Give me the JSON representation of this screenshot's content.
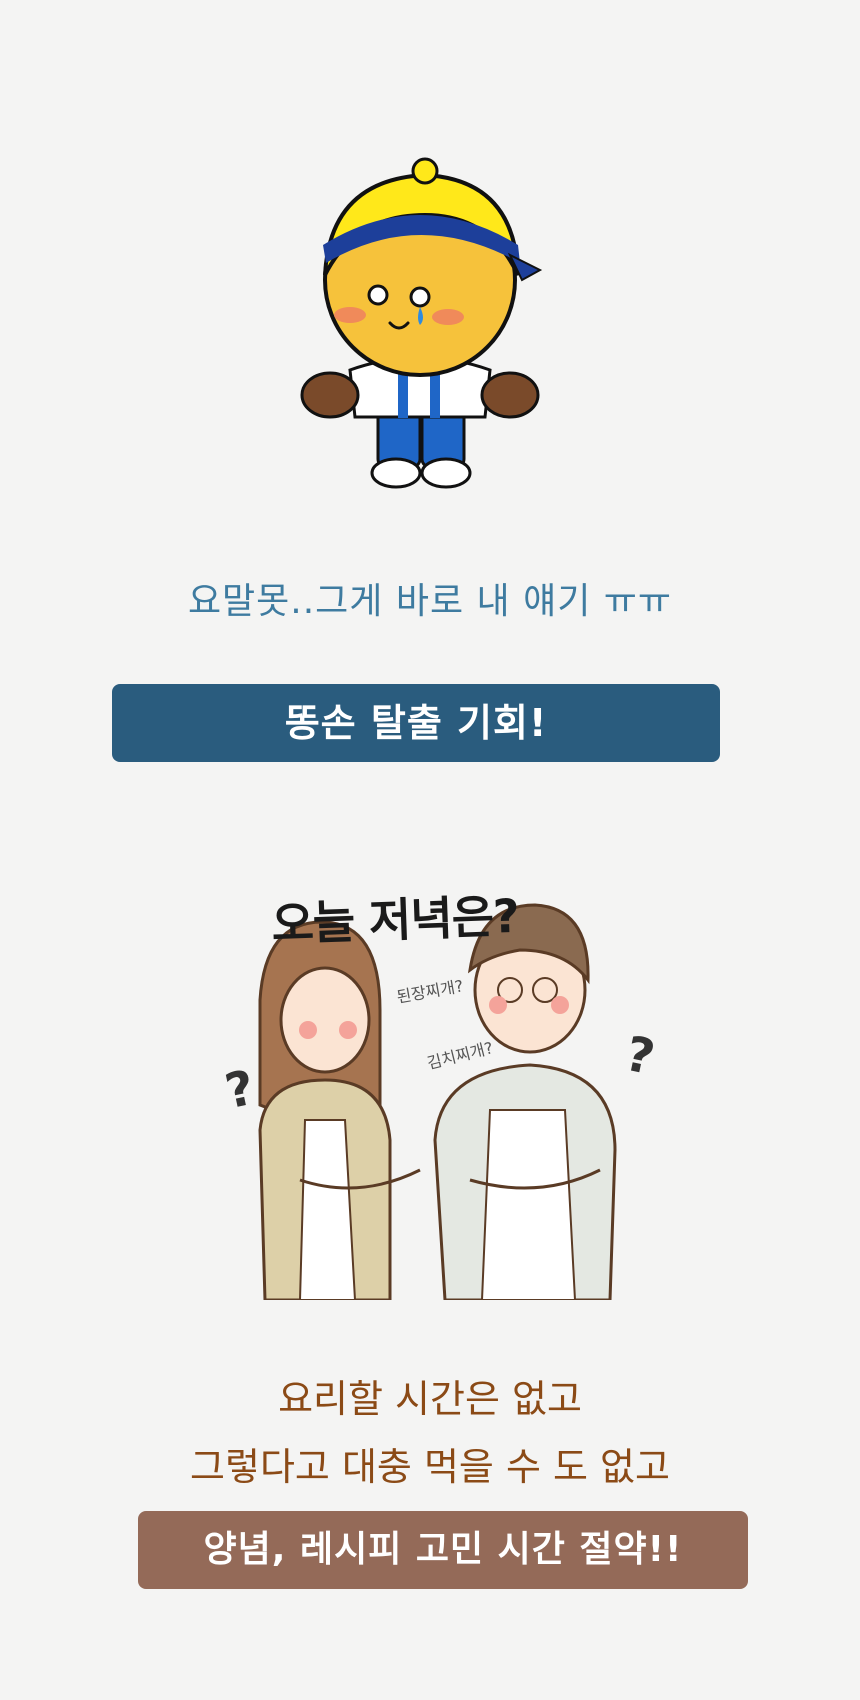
{
  "section1": {
    "caption": "요말못..그게 바로 내 얘기 ㅠㅠ",
    "banner": "똥손 탈출 기회!"
  },
  "section2": {
    "heading": "오늘 저녁은?",
    "bubble_top": "된장찌개?",
    "bubble_bottom": "김치찌개?",
    "question_mark_left": "?",
    "question_mark_right": "?",
    "line1": "요리할 시간은 없고",
    "line2": "그렇다고 대충 먹을 수 도 없고",
    "banner": "양념, 레시피 고민 시간 절약!!"
  },
  "colors": {
    "background": "#f4f4f3",
    "caption_blue": "#3e7ba0",
    "banner_blue": "#2a5c7e",
    "text_brown": "#8b4a16",
    "banner_brown": "#946a58"
  },
  "icons": [
    "crying-mascot-illustration",
    "thinking-couple-illustration"
  ]
}
